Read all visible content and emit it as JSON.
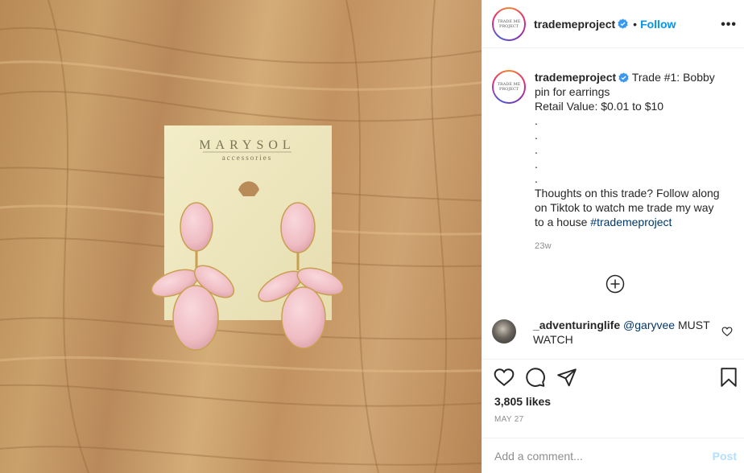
{
  "post": {
    "username": "trademeproject",
    "follow_label": "Follow",
    "dot": "•",
    "more_label": "•••",
    "avatar_text": "TRADE ME PROJECT",
    "caption": {
      "line1": "Trade #1: Bobby",
      "line2": "pin for earrings",
      "line3": "Retail Value: $0.01 to $10",
      "dot": ".",
      "line4": "Thoughts on this trade? Follow along",
      "line5": "on Tiktok to watch me trade my way",
      "line6_prefix": "to a house ",
      "hashtag": "#trademeproject"
    },
    "time_ago": "23w",
    "comment": {
      "username": "_adventuringlife",
      "mention": "@garyvee",
      "text": " MUST",
      "text2": "WATCH"
    },
    "likes": "3,805 likes",
    "date": "MAY 27",
    "add_comment_placeholder": "Add a comment...",
    "post_label": "Post"
  },
  "photo": {
    "brand": "MARYSOL",
    "brand_sub": "accessories"
  },
  "colors": {
    "link_blue": "#0095f6",
    "hashtag_blue": "#00376b",
    "verified_blue": "#3897f0",
    "earring_pink": "#f1c0c6"
  },
  "icons": [
    "verified-icon",
    "more-icon",
    "add-comment-icon",
    "heart-icon",
    "comment-icon",
    "share-icon",
    "bookmark-icon"
  ]
}
